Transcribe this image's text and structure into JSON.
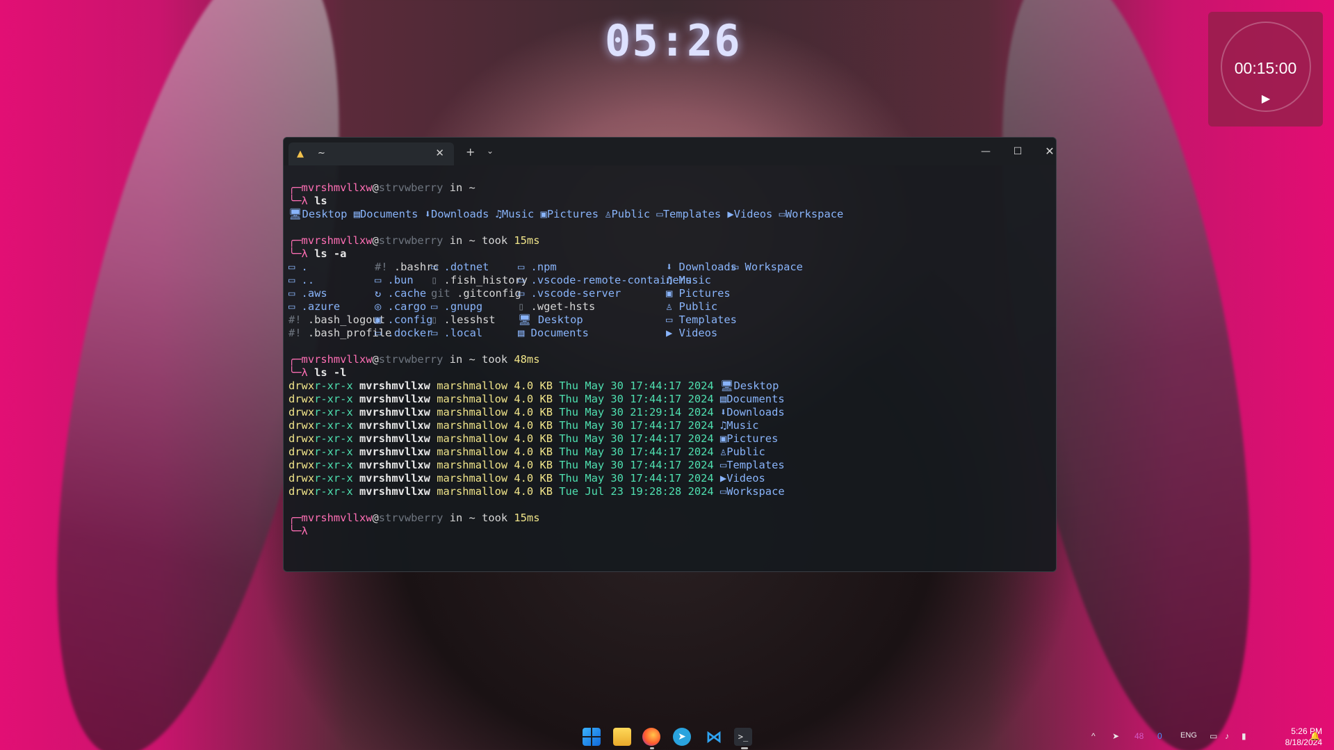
{
  "desktop": {
    "clock": "05:26",
    "timer": {
      "time": "00:15:00",
      "play_icon": "▶"
    }
  },
  "terminal": {
    "tab_title": "~",
    "tab_close": "✕",
    "new_tab": "+",
    "dropdown": "⌄",
    "min": "—",
    "max": "☐",
    "close": "✕",
    "user": "mvrshmvllxw",
    "at": "@",
    "host": "strvwberry",
    "in_tilde": " in ~",
    "took": " took ",
    "prompt_symbol": "λ",
    "blocks": [
      {
        "took_time": "",
        "command": "ls"
      },
      {
        "took_time": "15ms",
        "command": "ls -a"
      },
      {
        "took_time": "48ms",
        "command": "ls -l"
      },
      {
        "took_time": "15ms",
        "command": ""
      }
    ],
    "ls_items": [
      {
        "icon": "🖥",
        "name": "Desktop"
      },
      {
        "icon": "▤",
        "name": "Documents"
      },
      {
        "icon": "⬇",
        "name": "Downloads"
      },
      {
        "icon": "♫",
        "name": "Music"
      },
      {
        "icon": "▣",
        "name": "Pictures"
      },
      {
        "icon": "♙",
        "name": "Public"
      },
      {
        "icon": "▭",
        "name": "Templates"
      },
      {
        "icon": "▶",
        "name": "Videos"
      },
      {
        "icon": "▭",
        "name": "Workspace"
      }
    ],
    "ls_a_columns": [
      [
        {
          "icon": "▭",
          "name": "."
        },
        {
          "icon": "▭",
          "name": ".."
        },
        {
          "icon": "▭",
          "name": ".aws"
        },
        {
          "icon": "▭",
          "name": ".azure"
        },
        {
          "icon": "#!",
          "name": ".bash_logout"
        },
        {
          "icon": "#!",
          "name": ".bash_profile"
        }
      ],
      [
        {
          "icon": "#!",
          "name": ".bashrc"
        },
        {
          "icon": "▭",
          "name": ".bun"
        },
        {
          "icon": "↻",
          "name": ".cache"
        },
        {
          "icon": "◎",
          "name": ".cargo"
        },
        {
          "icon": "▣",
          "name": ".config"
        },
        {
          "icon": "▭",
          "name": ".docker"
        }
      ],
      [
        {
          "icon": "▭",
          "name": ".dotnet"
        },
        {
          "icon": "▯",
          "name": ".fish_history"
        },
        {
          "icon": "git",
          "name": ".gitconfig"
        },
        {
          "icon": "▭",
          "name": ".gnupg"
        },
        {
          "icon": "▯",
          "name": ".lesshst"
        },
        {
          "icon": "▭",
          "name": ".local"
        }
      ],
      [
        {
          "icon": "▭",
          "name": ".npm"
        },
        {
          "icon": "▭",
          "name": ".vscode-remote-containers"
        },
        {
          "icon": "▭",
          "name": ".vscode-server"
        },
        {
          "icon": "▯",
          "name": ".wget-hsts"
        },
        {
          "icon": "🖥",
          "name": "Desktop"
        },
        {
          "icon": "▤",
          "name": "Documents"
        }
      ],
      [
        {
          "icon": "⬇",
          "name": "Downloads"
        },
        {
          "icon": "♫",
          "name": "Music"
        },
        {
          "icon": "▣",
          "name": "Pictures"
        },
        {
          "icon": "♙",
          "name": "Public"
        },
        {
          "icon": "▭",
          "name": "Templates"
        },
        {
          "icon": "▶",
          "name": "Videos"
        }
      ],
      [
        {
          "icon": "▭",
          "name": "Workspace"
        }
      ]
    ],
    "ls_l_rows": [
      {
        "perm": "drwxr-xr-x",
        "owner": "mvrshmvllxw",
        "group": "marshmallow",
        "size": "4.0 KB",
        "date": "Thu May 30 17:44:17 2024",
        "icon": "🖥",
        "name": "Desktop"
      },
      {
        "perm": "drwxr-xr-x",
        "owner": "mvrshmvllxw",
        "group": "marshmallow",
        "size": "4.0 KB",
        "date": "Thu May 30 17:44:17 2024",
        "icon": "▤",
        "name": "Documents"
      },
      {
        "perm": "drwxr-xr-x",
        "owner": "mvrshmvllxw",
        "group": "marshmallow",
        "size": "4.0 KB",
        "date": "Thu May 30 21:29:14 2024",
        "icon": "⬇",
        "name": "Downloads"
      },
      {
        "perm": "drwxr-xr-x",
        "owner": "mvrshmvllxw",
        "group": "marshmallow",
        "size": "4.0 KB",
        "date": "Thu May 30 17:44:17 2024",
        "icon": "♫",
        "name": "Music"
      },
      {
        "perm": "drwxr-xr-x",
        "owner": "mvrshmvllxw",
        "group": "marshmallow",
        "size": "4.0 KB",
        "date": "Thu May 30 17:44:17 2024",
        "icon": "▣",
        "name": "Pictures"
      },
      {
        "perm": "drwxr-xr-x",
        "owner": "mvrshmvllxw",
        "group": "marshmallow",
        "size": "4.0 KB",
        "date": "Thu May 30 17:44:17 2024",
        "icon": "♙",
        "name": "Public"
      },
      {
        "perm": "drwxr-xr-x",
        "owner": "mvrshmvllxw",
        "group": "marshmallow",
        "size": "4.0 KB",
        "date": "Thu May 30 17:44:17 2024",
        "icon": "▭",
        "name": "Templates"
      },
      {
        "perm": "drwxr-xr-x",
        "owner": "mvrshmvllxw",
        "group": "marshmallow",
        "size": "4.0 KB",
        "date": "Thu May 30 17:44:17 2024",
        "icon": "▶",
        "name": "Videos"
      },
      {
        "perm": "drwxr-xr-x",
        "owner": "mvrshmvllxw",
        "group": "marshmallow",
        "size": "4.0 KB",
        "date": "Tue Jul 23 19:28:28 2024",
        "icon": "▭",
        "name": "Workspace"
      }
    ]
  },
  "taskbar": {
    "terminal_icon_text": ">_",
    "telegram_icon_text": "➤",
    "vscode_icon_text": "⋈",
    "tray": {
      "chevron": "^",
      "send_icon": "➤",
      "count_a": "48",
      "count_b": "0",
      "lang": "ENG",
      "time": "5:26 PM",
      "date": "8/18/2024"
    }
  }
}
